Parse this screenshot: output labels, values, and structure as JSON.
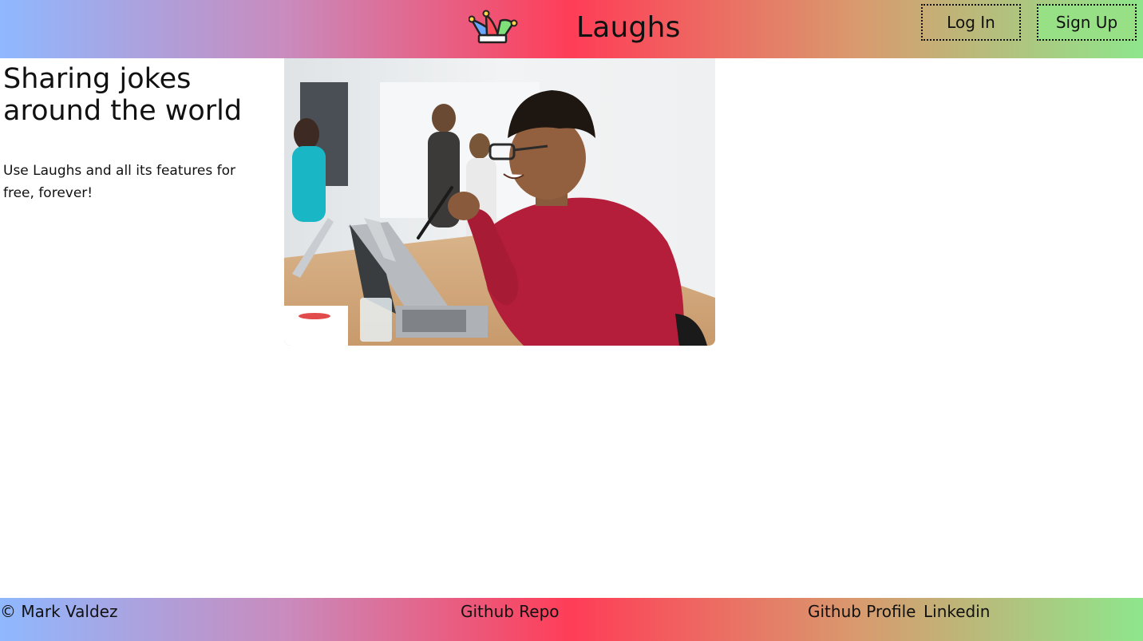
{
  "header": {
    "brand": "Laughs",
    "logo_icon": "jester-hat-icon",
    "login_label": "Log In",
    "signup_label": "Sign Up"
  },
  "hero": {
    "title": "Sharing jokes around the world",
    "subtitle": "Use Laughs and all its features for free, forever!",
    "image_icon": "office-laughing-person-photo"
  },
  "footer": {
    "copyright": "© Mark Valdez",
    "github_repo": "Github Repo",
    "github_profile": "Github Profile",
    "linkedin": "Linkedin"
  },
  "colors": {
    "gradient_start": "#8fb8ff",
    "gradient_mid": "#ff3d57",
    "gradient_end": "#8ee68c",
    "signup_bg": "#98e085"
  }
}
